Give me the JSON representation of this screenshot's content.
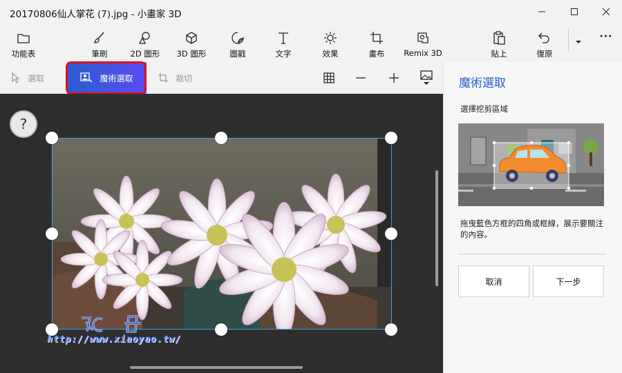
{
  "window": {
    "title": "20170806仙人掌花 (7).jpg - 小畫家 3D",
    "controls": [
      "minimize-icon",
      "maximize-icon",
      "close-icon"
    ]
  },
  "toolbar": {
    "menu_label": "功能表",
    "brushes_label": "筆刷",
    "shapes2d_label": "2D 圖形",
    "shapes3d_label": "3D 圖形",
    "stickers_label": "圖戳",
    "text_label": "文字",
    "effects_label": "效果",
    "canvas_label": "畫布",
    "remix_label": "Remix 3D",
    "paste_label": "貼上",
    "undo_label": "復原",
    "more_symbol": "···"
  },
  "subbar": {
    "select_label": "選取",
    "magic_select_label": "魔術選取",
    "crop_label": "裁切",
    "highlight_color": "#e0101f",
    "active_gradient": [
      "#2b5ccf",
      "#5a4df0"
    ]
  },
  "canvas": {
    "help_symbol": "?",
    "selection_color": "#3aa4e8",
    "watermark_text": "http://www.xiaoyao.tw/"
  },
  "panel": {
    "title": "魔術選取",
    "subtitle": "選擇挖剪區域",
    "description": "拖曳藍色方框的四角或框線，展示要關注的內容。",
    "cancel_label": "取消",
    "next_label": "下一步",
    "accent_color": "#2a5fc9"
  }
}
